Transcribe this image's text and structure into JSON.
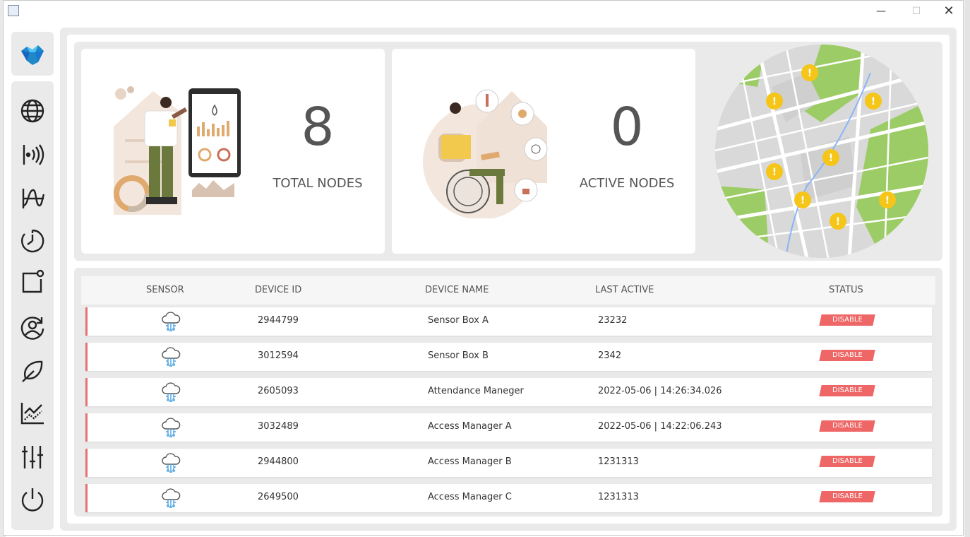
{
  "window": {
    "minimize_glyph": "—",
    "maximize_glyph": "☐",
    "close_glyph": "✕"
  },
  "sidebar": {
    "items": [
      {
        "name": "globe-icon"
      },
      {
        "name": "signal-icon"
      },
      {
        "name": "waveform-icon"
      },
      {
        "name": "timer-icon"
      },
      {
        "name": "notification-icon"
      },
      {
        "name": "user-refresh-icon"
      },
      {
        "name": "leaf-icon"
      },
      {
        "name": "chart-icon"
      },
      {
        "name": "sliders-icon"
      },
      {
        "name": "power-icon"
      }
    ]
  },
  "stats": {
    "total_nodes": "8",
    "total_label": "TOTAL NODES",
    "active_nodes": "0",
    "active_label": "ACTIVE NODES"
  },
  "table": {
    "headers": [
      "SENSOR",
      "DEVICE ID",
      "DEVICE NAME",
      "LAST ACTIVE",
      "STATUS"
    ],
    "rows": [
      {
        "device_id": "2944799",
        "device_name": "Sensor Box A",
        "last_active": "23232",
        "status": "DISABLE"
      },
      {
        "device_id": "3012594",
        "device_name": "Sensor Box B",
        "last_active": "2342",
        "status": "DISABLE"
      },
      {
        "device_id": "2605093",
        "device_name": "Attendance Maneger",
        "last_active": "2022-05-06 | 14:26:34.026",
        "status": "DISABLE"
      },
      {
        "device_id": "3032489",
        "device_name": "Access Manager A",
        "last_active": "2022-05-06 | 14:22:06.243",
        "status": "DISABLE"
      },
      {
        "device_id": "2944800",
        "device_name": "Access Manager B",
        "last_active": "1231313",
        "status": "DISABLE"
      },
      {
        "device_id": "2649500",
        "device_name": "Access Manager C",
        "last_active": "1231313",
        "status": "DISABLE"
      }
    ]
  },
  "colors": {
    "accent_red": "#ee6666",
    "map_green": "#9ccc65",
    "warning_yellow": "#f5c518",
    "logo_blue": "#1e88c8"
  }
}
